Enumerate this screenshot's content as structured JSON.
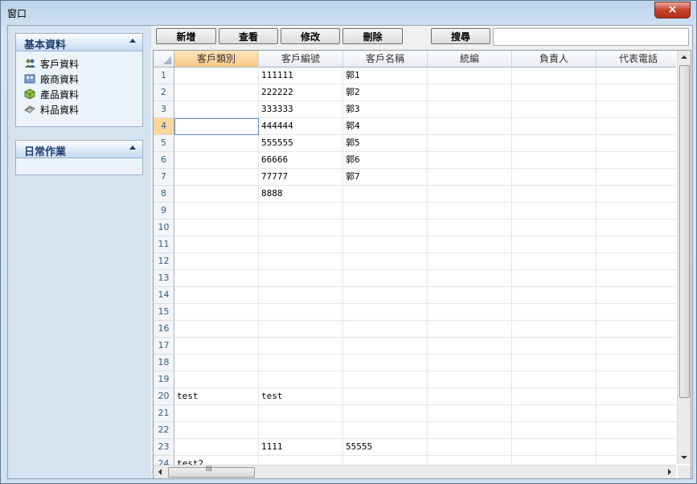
{
  "window": {
    "title": "窗口",
    "close_label": "×"
  },
  "sidebar": {
    "panels": [
      {
        "title": "基本資料",
        "items": [
          {
            "label": "客戶資料",
            "icon": "customers-icon"
          },
          {
            "label": "廠商資料",
            "icon": "vendors-icon"
          },
          {
            "label": "產品資料",
            "icon": "products-icon"
          },
          {
            "label": "料品資料",
            "icon": "materials-icon"
          }
        ]
      },
      {
        "title": "日常作業",
        "items": []
      }
    ]
  },
  "toolbar": {
    "add": "新增",
    "view": "查看",
    "edit": "修改",
    "delete": "刪除",
    "search": "搜尋",
    "search_value": ""
  },
  "grid": {
    "columns": [
      "客戶類別",
      "客戶編號",
      "客戶名稱",
      "統編",
      "負責人",
      "代表電話"
    ],
    "active_column": 0,
    "active_row": 4,
    "rows": [
      {
        "no": "1",
        "cells": [
          "",
          "111111",
          "郭1",
          "",
          "",
          ""
        ]
      },
      {
        "no": "2",
        "cells": [
          "",
          "222222",
          "郭2",
          "",
          "",
          ""
        ]
      },
      {
        "no": "3",
        "cells": [
          "",
          "333333",
          "郭3",
          "",
          "",
          ""
        ]
      },
      {
        "no": "4",
        "cells": [
          "",
          "444444",
          "郭4",
          "",
          "",
          ""
        ]
      },
      {
        "no": "5",
        "cells": [
          "",
          "555555",
          "郭5",
          "",
          "",
          ""
        ]
      },
      {
        "no": "6",
        "cells": [
          "",
          "66666",
          "郭6",
          "",
          "",
          ""
        ]
      },
      {
        "no": "7",
        "cells": [
          "",
          "77777",
          "郭7",
          "",
          "",
          ""
        ]
      },
      {
        "no": "8",
        "cells": [
          "",
          "8888",
          "",
          "",
          "",
          ""
        ]
      },
      {
        "no": "9",
        "cells": [
          "",
          "",
          "",
          "",
          "",
          ""
        ]
      },
      {
        "no": "10",
        "cells": [
          "",
          "",
          "",
          "",
          "",
          ""
        ]
      },
      {
        "no": "11",
        "cells": [
          "",
          "",
          "",
          "",
          "",
          ""
        ]
      },
      {
        "no": "12",
        "cells": [
          "",
          "",
          "",
          "",
          "",
          ""
        ]
      },
      {
        "no": "13",
        "cells": [
          "",
          "",
          "",
          "",
          "",
          ""
        ]
      },
      {
        "no": "14",
        "cells": [
          "",
          "",
          "",
          "",
          "",
          ""
        ]
      },
      {
        "no": "15",
        "cells": [
          "",
          "",
          "",
          "",
          "",
          ""
        ]
      },
      {
        "no": "16",
        "cells": [
          "",
          "",
          "",
          "",
          "",
          ""
        ]
      },
      {
        "no": "17",
        "cells": [
          "",
          "",
          "",
          "",
          "",
          ""
        ]
      },
      {
        "no": "18",
        "cells": [
          "",
          "",
          "",
          "",
          "",
          ""
        ]
      },
      {
        "no": "19",
        "cells": [
          "",
          "",
          "",
          "",
          "",
          ""
        ]
      },
      {
        "no": "20",
        "cells": [
          "test",
          "test",
          "",
          "",
          "",
          ""
        ]
      },
      {
        "no": "21",
        "cells": [
          "",
          "",
          "",
          "",
          "",
          ""
        ]
      },
      {
        "no": "22",
        "cells": [
          "",
          "",
          "",
          "",
          "",
          ""
        ]
      },
      {
        "no": "23",
        "cells": [
          "",
          "1111",
          "55555",
          "",
          "",
          ""
        ]
      },
      {
        "no": "24",
        "cells": [
          "test2",
          "",
          "",
          "",
          "",
          ""
        ]
      }
    ],
    "hscroll_grip": "III"
  }
}
